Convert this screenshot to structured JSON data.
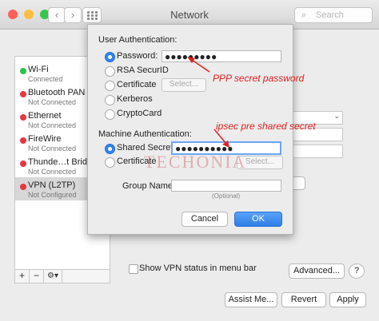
{
  "window": {
    "title": "Network"
  },
  "toolbar": {
    "back": "‹",
    "forward": "›",
    "search_placeholder": "Search"
  },
  "traffic_lights": {
    "close": "#fc605c",
    "minimize": "#fdbc40",
    "zoom": "#34c84a"
  },
  "services": [
    {
      "name": "Wi-Fi",
      "status": "Connected",
      "color": "#2cc04a"
    },
    {
      "name": "Bluetooth PAN",
      "status": "Not Connected",
      "color": "#e8373f"
    },
    {
      "name": "Ethernet",
      "status": "Not Connected",
      "color": "#e8373f"
    },
    {
      "name": "FireWire",
      "status": "Not Connected",
      "color": "#e8373f"
    },
    {
      "name": "Thunde…t Bridge",
      "status": "Not Connected",
      "color": "#e8373f"
    },
    {
      "name": "VPN (L2TP)",
      "status": "Not Configured",
      "color": "#e8373f"
    }
  ],
  "sidebar_tools": {
    "add": "+",
    "remove": "−",
    "gear": "⚙▾"
  },
  "main": {
    "show_vpn_status_label": "Show VPN status in menu bar",
    "advanced_label": "Advanced...",
    "help_label": "?",
    "assist_label": "Assist Me...",
    "revert_label": "Revert",
    "apply_label": "Apply"
  },
  "sheet": {
    "user_auth_title": "User Authentication:",
    "password_label": "Password:",
    "password_value": "●●●●●●●●●",
    "rsa_label": "RSA SecurID",
    "certificate_label": "Certificate",
    "select_label": "Select...",
    "kerberos_label": "Kerberos",
    "cryptocard_label": "CryptoCard",
    "machine_auth_title": "Machine Authentication:",
    "shared_secret_label": "Shared Secret:",
    "shared_secret_value": "●●●●●●●●●●",
    "machine_certificate_label": "Certificate",
    "machine_select_label": "Select...",
    "group_name_label": "Group Name:",
    "group_name_hint": "(Optional)",
    "cancel_label": "Cancel",
    "ok_label": "OK"
  },
  "annotations": {
    "ppp": "PPP secret password",
    "ipsec": "ipsec pre shared secret",
    "watermark": "TECHONIA"
  }
}
